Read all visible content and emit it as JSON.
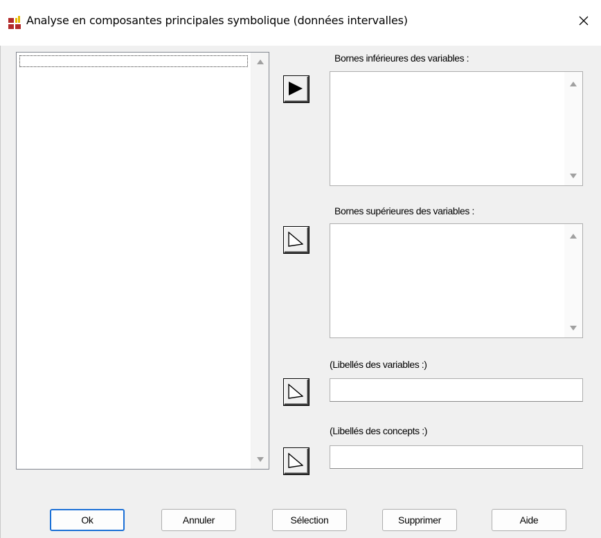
{
  "window": {
    "title": "Analyse en composantes principales symbolique (données intervalles)",
    "close_glyph": "✕"
  },
  "icons": {
    "app": "grid-app-icon",
    "close": "close-icon",
    "transfer": "right-arrow-icon"
  },
  "fields": {
    "lower_bounds_label": "Bornes inférieures des variables :",
    "upper_bounds_label": "Bornes supérieures des variables :",
    "variable_labels_label": "(Libellés des variables :)",
    "concept_labels_label": "(Libellés des concepts :)",
    "variable_labels_value": "",
    "concept_labels_value": ""
  },
  "buttons": {
    "ok": "Ok",
    "cancel": "Annuler",
    "selection": "Sélection",
    "delete": "Supprimer",
    "help": "Aide"
  },
  "colors": {
    "accent": "#1a6fd6",
    "icon_red": "#c0392b",
    "icon_yellow": "#e6b800"
  }
}
